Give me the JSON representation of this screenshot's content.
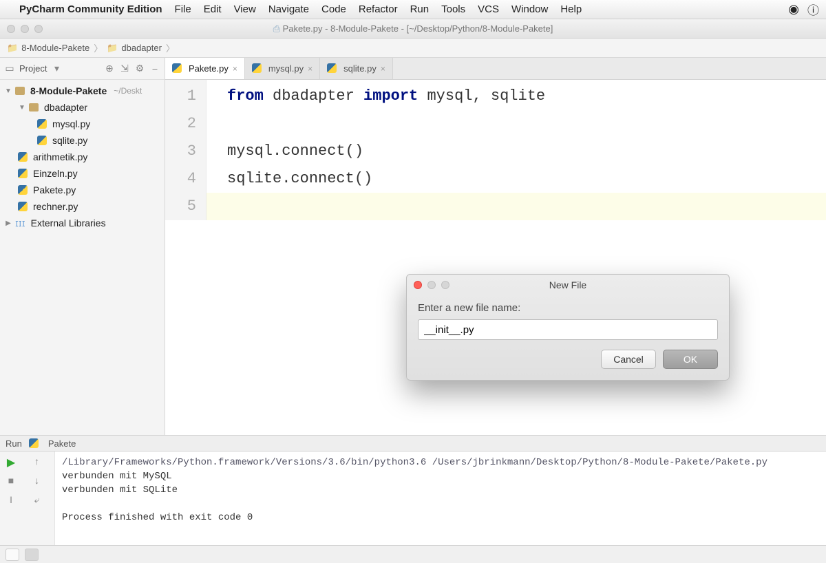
{
  "menubar": {
    "app": "PyCharm Community Edition",
    "items": [
      "File",
      "Edit",
      "View",
      "Navigate",
      "Code",
      "Refactor",
      "Run",
      "Tools",
      "VCS",
      "Window",
      "Help"
    ]
  },
  "window": {
    "title": "Pakete.py - 8-Module-Pakete - [~/Desktop/Python/8-Module-Pakete]"
  },
  "breadcrumb": {
    "root": "8-Module-Pakete",
    "sub": "dbadapter"
  },
  "sidebar": {
    "title": "Project",
    "root": "8-Module-Pakete",
    "root_path": "~/Deskt",
    "folder": "dbadapter",
    "files_in_folder": [
      "mysql.py",
      "sqlite.py"
    ],
    "root_files": [
      "arithmetik.py",
      "Einzeln.py",
      "Pakete.py",
      "rechner.py"
    ],
    "external": "External Libraries"
  },
  "tabs": [
    {
      "label": "Pakete.py",
      "active": true
    },
    {
      "label": "mysql.py",
      "active": false
    },
    {
      "label": "sqlite.py",
      "active": false
    }
  ],
  "editor": {
    "lines": [
      "1",
      "2",
      "3",
      "4",
      "5"
    ],
    "tokens": {
      "l1_from": "from",
      "l1_mod": "dbadapter",
      "l1_import": "import",
      "l1_rest": "mysql, sqlite",
      "l3": "mysql.connect()",
      "l4": "sqlite.connect()"
    }
  },
  "run": {
    "header_label": "Run",
    "config": "Pakete",
    "line1": "/Library/Frameworks/Python.framework/Versions/3.6/bin/python3.6 /Users/jbrinkmann/Desktop/Python/8-Module-Pakete/Pakete.py",
    "line2": "verbunden mit MySQL",
    "line3": "verbunden mit SQLite",
    "line4": "",
    "line5": "Process finished with exit code 0"
  },
  "dialog": {
    "title": "New File",
    "prompt": "Enter a new file name:",
    "value": "__init__.py",
    "cancel": "Cancel",
    "ok": "OK"
  }
}
